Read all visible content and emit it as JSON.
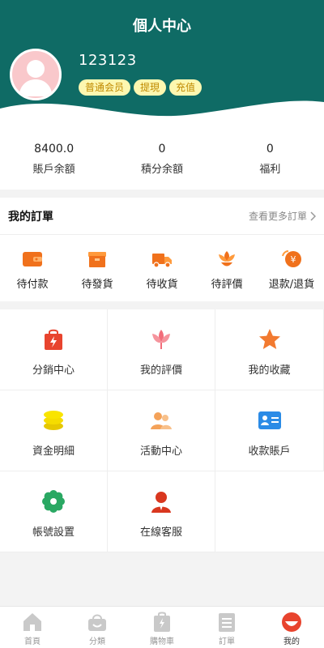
{
  "header": {
    "title": "個人中心",
    "username": "123123",
    "tags": [
      "普通会员",
      "提現",
      "充值"
    ],
    "bg_color": "#0f6b65"
  },
  "stats": [
    {
      "value": "8400.0",
      "label": "賬戶余額"
    },
    {
      "value": "0",
      "label": "積分余額"
    },
    {
      "value": "0",
      "label": "福利"
    }
  ],
  "orders": {
    "title": "我的訂單",
    "more": "查看更多訂單",
    "items": [
      {
        "label": "待付款",
        "icon": "wallet-icon"
      },
      {
        "label": "待發貨",
        "icon": "box-icon"
      },
      {
        "label": "待收貨",
        "icon": "truck-icon"
      },
      {
        "label": "待評價",
        "icon": "flower-icon"
      },
      {
        "label": "退款/退貨",
        "icon": "refund-icon"
      }
    ]
  },
  "services": [
    {
      "label": "分銷中心",
      "icon": "shopping-bag-icon"
    },
    {
      "label": "我的評價",
      "icon": "tulip-icon"
    },
    {
      "label": "我的收藏",
      "icon": "star-icon"
    },
    {
      "label": "資金明細",
      "icon": "coins-icon"
    },
    {
      "label": "活動中心",
      "icon": "people-icon"
    },
    {
      "label": "收款賬戶",
      "icon": "id-card-icon"
    },
    {
      "label": "帳號設置",
      "icon": "gear-icon"
    },
    {
      "label": "在線客服",
      "icon": "agent-icon"
    }
  ],
  "nav": [
    {
      "label": "首頁",
      "icon": "home-icon"
    },
    {
      "label": "分類",
      "icon": "basket-icon"
    },
    {
      "label": "購物車",
      "icon": "cart-icon"
    },
    {
      "label": "訂單",
      "icon": "list-icon"
    },
    {
      "label": "我的",
      "icon": "user-icon",
      "active": true
    }
  ]
}
